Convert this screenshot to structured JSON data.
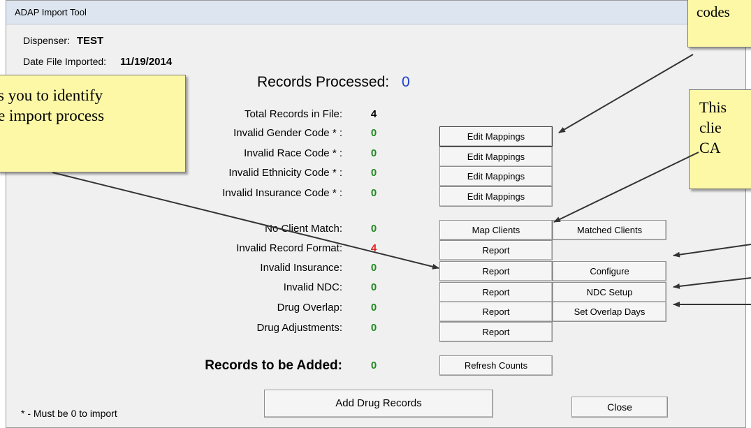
{
  "window": {
    "title": "ADAP Import Tool"
  },
  "header": {
    "dispenser_label": "Dispenser:",
    "dispenser_value": "TEST",
    "date_label": "Date File Imported:",
    "date_value": "11/19/2014",
    "processed_label": "Records Processed:",
    "processed_value": "0"
  },
  "rows": [
    {
      "label": "Total Records in File:",
      "count": "4"
    },
    {
      "label": "Invalid Gender Code * :",
      "count": "0",
      "button": "Edit Mappings"
    },
    {
      "label": "Invalid Race Code * :",
      "count": "0",
      "button": "Edit Mappings"
    },
    {
      "label": "Invalid Ethnicity Code * :",
      "count": "0",
      "button": "Edit Mappings"
    },
    {
      "label": "Invalid Insurance Code * :",
      "count": "0",
      "button": "Edit Mappings"
    },
    {
      "label": "No Client Match:",
      "count": "0",
      "button": "Map Clients",
      "button2": "Matched Clients"
    },
    {
      "label": "Invalid Record Format:",
      "count": "4",
      "button": "Report"
    },
    {
      "label": "Invalid Insurance:",
      "count": "0",
      "button": "Report",
      "button2": "Configure"
    },
    {
      "label": "Invalid NDC:",
      "count": "0",
      "button": "Report",
      "button2": "NDC Setup"
    },
    {
      "label": "Drug Overlap:",
      "count": "0",
      "button": "Report",
      "button2": "Set Overlap Days"
    },
    {
      "label": "Drug Adjustments:",
      "count": "0",
      "button": "Report"
    }
  ],
  "added": {
    "label": "Records to be Added:",
    "count": "0",
    "refresh_button": "Refresh Counts"
  },
  "footer": {
    "note": "* - Must be 0 to import",
    "add_button": "Add Drug Records",
    "close_button": "Close"
  },
  "callouts": {
    "top_right": "codes",
    "left_line1": "s you to identify",
    "left_line2": "e import process",
    "right_line1": "This",
    "right_line2": "clie",
    "right_line3": "CA"
  },
  "colors": {
    "count_ok": "#1e8a1e",
    "count_error": "#e0201a",
    "processed": "#1f3fd1",
    "callout": "#fdf8a6"
  }
}
